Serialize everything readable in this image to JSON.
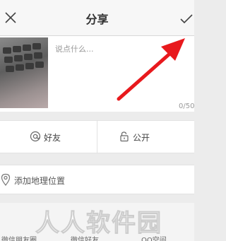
{
  "header": {
    "title": "分享",
    "close_icon": "close-icon",
    "send_icon": "checkmark-icon"
  },
  "compose": {
    "placeholder": "说点什么...",
    "char_counter": "0/50"
  },
  "options": {
    "mention_label": "好友",
    "mention_icon": "at-sign-icon",
    "privacy_label": "公开",
    "privacy_icon": "unlock-icon"
  },
  "location": {
    "label": "添加地理位置",
    "icon": "location-pin-icon"
  },
  "share_targets": {
    "items": [
      "微信朋友圈",
      "微信好友",
      "QQ空间"
    ]
  },
  "watermark": {
    "text": "人人软件园"
  },
  "colors": {
    "accent_arrow": "#e8191d",
    "background": "#ececec",
    "panel": "#ffffff"
  }
}
